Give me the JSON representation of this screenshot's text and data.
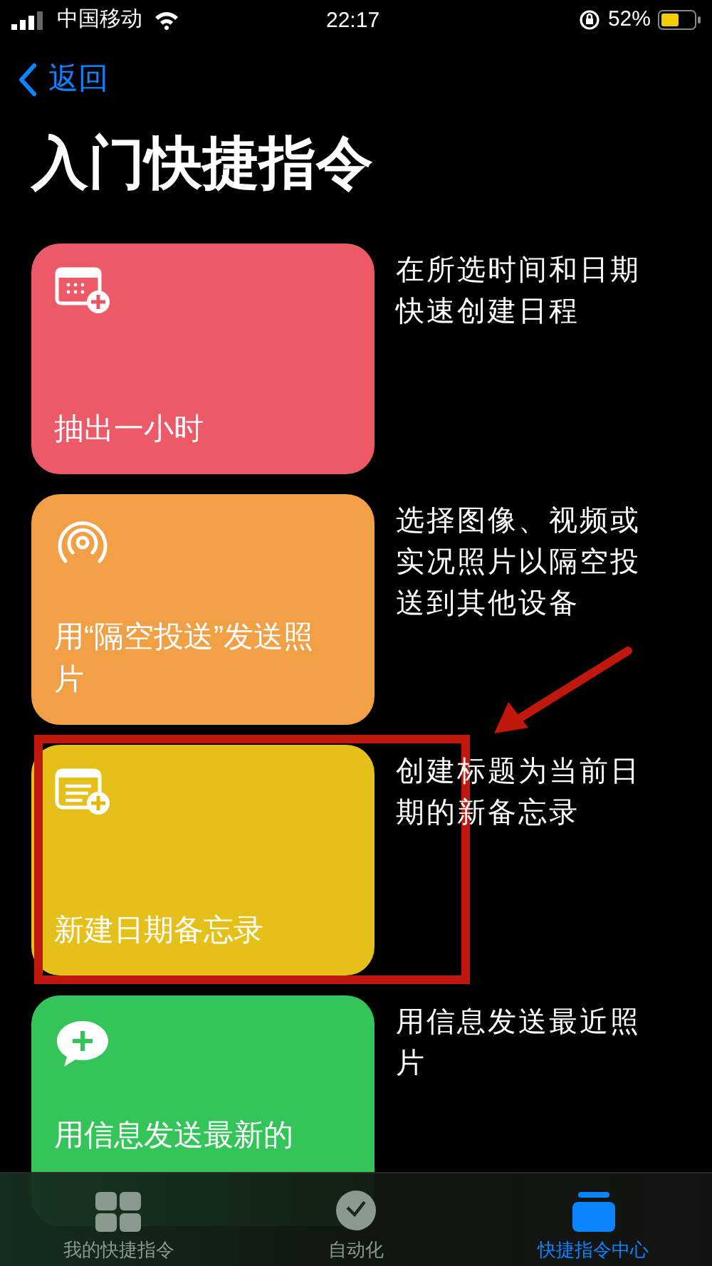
{
  "status_bar": {
    "carrier": "中国移动",
    "time": "22:17",
    "battery": "52%"
  },
  "nav": {
    "back": "返回"
  },
  "title": "入门快捷指令",
  "shortcuts": [
    {
      "title": "抽出一小时",
      "description": "在所选时间和日期快速创建日程",
      "color": "#ec5a67"
    },
    {
      "title": "用“隔空投送”发送照片",
      "description": "选择图像、视频或实况照片以隔空投送到其他设备",
      "color": "#f2a046"
    },
    {
      "title": "新建日期备忘录",
      "description": "创建标题为当前日期的新备忘录",
      "color": "#e6c01a"
    },
    {
      "title": "用信息发送最新的",
      "description": "用信息发送最近照片",
      "color": "#34c45a"
    }
  ],
  "tab_bar": [
    {
      "label": "我的快捷指令",
      "selected": false
    },
    {
      "label": "自动化",
      "selected": false
    },
    {
      "label": "快捷指令中心",
      "selected": true
    }
  ],
  "annotation": {
    "kind": "highlight"
  }
}
